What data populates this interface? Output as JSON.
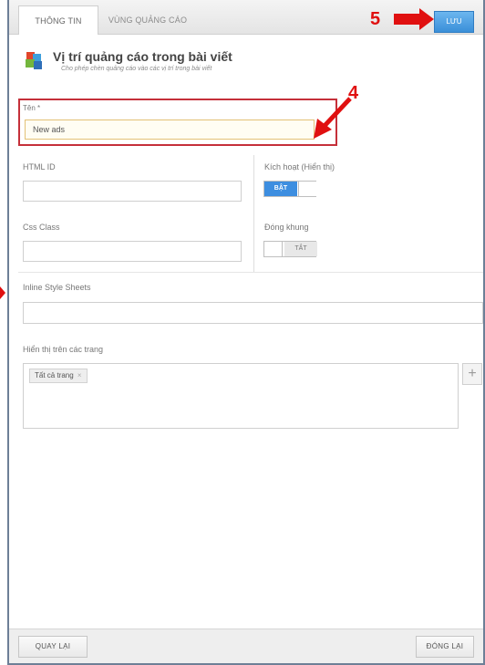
{
  "tabs": [
    {
      "label": "THÔNG TIN",
      "active": true
    },
    {
      "label": "VÙNG QUẢNG CÁO",
      "active": false
    }
  ],
  "toolbar": {
    "save_label": "LƯU"
  },
  "annotations": {
    "marker_4": "4",
    "marker_5": "5",
    "color": "#e01010"
  },
  "header": {
    "title": "Vị trí quảng cáo trong bài viết",
    "subtitle": "Cho phép chèn quảng cáo vào các vị trí trong bài viết"
  },
  "form": {
    "name": {
      "label": "Tên *",
      "value": "New ads"
    },
    "html_id": {
      "label": "HTML ID",
      "value": ""
    },
    "css_class": {
      "label": "Css Class",
      "value": ""
    },
    "active": {
      "label": "Kích hoạt (Hiển thị)",
      "state": "BẬT"
    },
    "frame": {
      "label": "Đóng khung",
      "state": "TẮT"
    },
    "inline_style": {
      "label": "Inline Style Sheets",
      "value": ""
    },
    "pages": {
      "label": "Hiển thị trên các trang",
      "tags": [
        "Tất cả trang"
      ],
      "remove_glyph": "×",
      "add_glyph": "+"
    }
  },
  "footer": {
    "back_label": "QUAY LẠI",
    "close_label": "ĐÓNG LẠI"
  },
  "colors": {
    "accent": "#3d8ee0",
    "highlight_border": "#c5303a",
    "annotation": "#e01010"
  }
}
